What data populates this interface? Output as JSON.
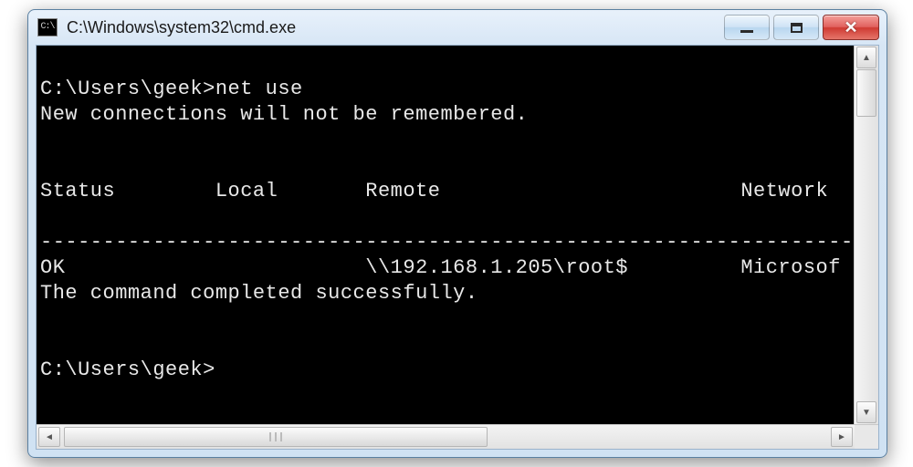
{
  "window": {
    "title": "C:\\Windows\\system32\\cmd.exe",
    "app_icon_text": "C:\\"
  },
  "console": {
    "prompt_dir": "C:\\Users\\geek",
    "command": "net use",
    "message": "New connections will not be remembered.",
    "headers": {
      "status": "Status",
      "local": "Local",
      "remote": "Remote",
      "network": "Network"
    },
    "separator": "-------------------------------------------------------------------------------",
    "rows": [
      {
        "status": "OK",
        "local": "",
        "remote": "\\\\192.168.1.205\\root$",
        "network": "Microsof"
      }
    ],
    "completion": "The command completed successfully.",
    "next_prompt": "C:\\Users\\geek>"
  },
  "scroll": {
    "up": "▲",
    "down": "▼",
    "left": "◄",
    "right": "►"
  }
}
